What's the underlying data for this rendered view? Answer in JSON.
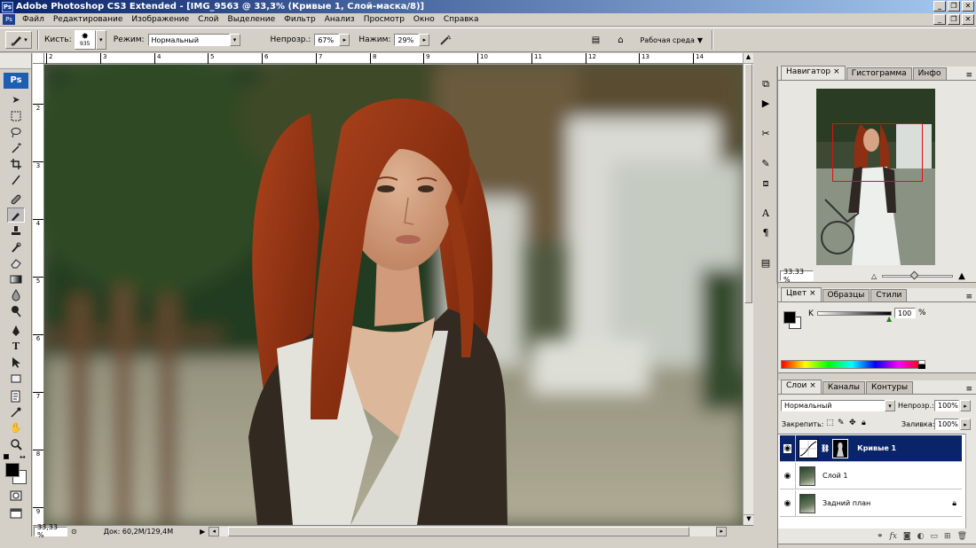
{
  "window": {
    "title": "Adobe Photoshop CS3 Extended - [IMG_9563 @ 33,3% (Кривые 1, Слой-маска/8)]",
    "app_icon": "Ps"
  },
  "menu": [
    "Файл",
    "Редактирование",
    "Изображение",
    "Слой",
    "Выделение",
    "Фильтр",
    "Анализ",
    "Просмотр",
    "Окно",
    "Справка"
  ],
  "options": {
    "brush_label": "Кисть:",
    "brush_size": "935",
    "mode_label": "Режим:",
    "mode_value": "Нормальный",
    "opacity_label": "Непрозр.:",
    "opacity_value": "67%",
    "flow_label": "Нажим:",
    "flow_value": "29%",
    "workspace_label": "Рабочая среда"
  },
  "toolbox": {
    "logo": "Ps"
  },
  "rulers": {
    "top": [
      "2",
      "3",
      "4",
      "5",
      "6",
      "7",
      "8",
      "9",
      "10",
      "11",
      "12",
      "13",
      "14"
    ],
    "left": [
      "2",
      "3",
      "4",
      "5",
      "6",
      "7",
      "8",
      "9"
    ]
  },
  "status": {
    "zoom": "33,33 %",
    "doc": "Док: 60,2M/129,4M"
  },
  "navigator": {
    "tabs": [
      "Навигатор",
      "Гистограмма",
      "Инфо"
    ],
    "zoom": "33.33 %",
    "slider_fraction": 0.45
  },
  "color_panel": {
    "tabs": [
      "Цвет",
      "Образцы",
      "Стили"
    ],
    "channel_label": "K",
    "value": "100",
    "unit": "%",
    "fg_color": "#000000",
    "bg_color": "#ffffff"
  },
  "layers_panel": {
    "tabs": [
      "Слои",
      "Каналы",
      "Контуры"
    ],
    "blend_mode": "Нормальный",
    "opacity_label": "Непрозр.:",
    "opacity_value": "100%",
    "lock_label": "Закрепить:",
    "fill_label": "Заливка:",
    "fill_value": "100%",
    "layers": [
      {
        "name": "Кривые 1",
        "selected": true
      },
      {
        "name": "Слой 1",
        "selected": false
      },
      {
        "name": "Задний план",
        "selected": false,
        "locked": true
      }
    ]
  },
  "colors": {
    "title_start": "#0a246a",
    "title_end": "#a6caf0",
    "selection": "#0a246a",
    "chrome": "#d4d0c8"
  }
}
